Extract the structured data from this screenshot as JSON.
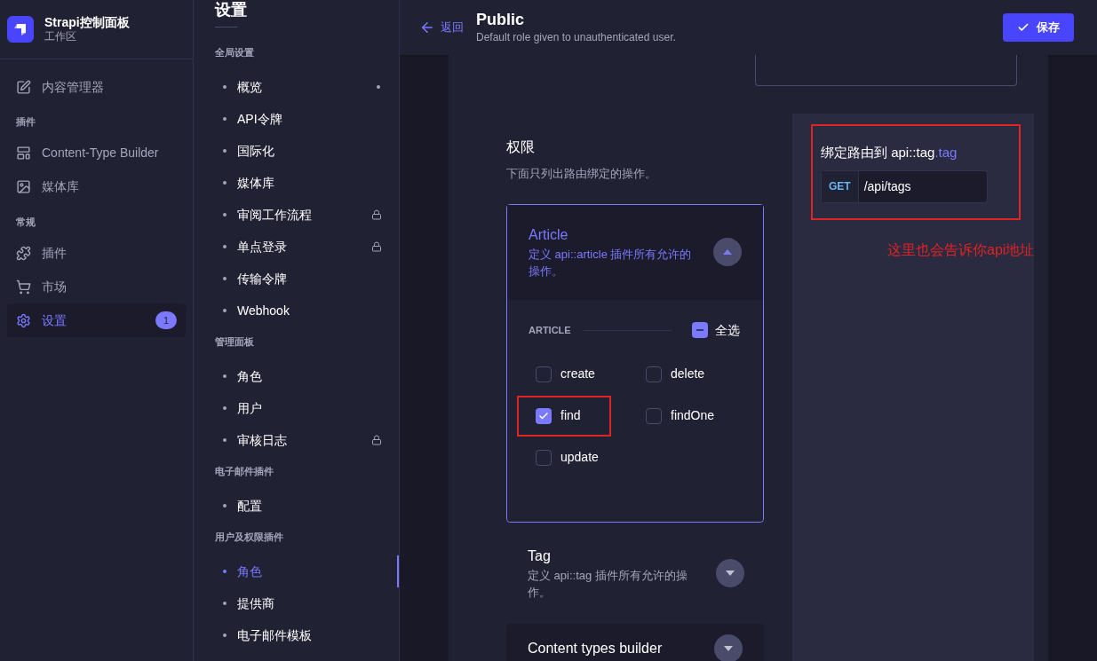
{
  "brand": {
    "title": "Strapi控制面板",
    "subtitle": "工作区"
  },
  "main_nav": [
    {
      "kind": "item",
      "label": "内容管理器",
      "selected": false
    },
    {
      "kind": "section",
      "label": "插件"
    },
    {
      "kind": "item",
      "label": "Content-Type Builder",
      "selected": false
    },
    {
      "kind": "item",
      "label": "媒体库",
      "selected": false
    },
    {
      "kind": "section",
      "label": "常规"
    },
    {
      "kind": "item",
      "label": "插件",
      "selected": false
    },
    {
      "kind": "item",
      "label": "市场",
      "selected": false
    },
    {
      "kind": "item",
      "label": "设置",
      "selected": true,
      "badge": "1"
    }
  ],
  "settings_nav": {
    "title": "设置",
    "sections": [
      {
        "label": "全局设置",
        "items": [
          {
            "label": "概览",
            "selected": false,
            "locked": false,
            "notice": true
          },
          {
            "label": "API令牌",
            "selected": false,
            "locked": false,
            "notice": false
          },
          {
            "label": "国际化",
            "selected": false,
            "locked": false,
            "notice": false
          },
          {
            "label": "媒体库",
            "selected": false,
            "locked": false,
            "notice": false
          },
          {
            "label": "审阅工作流程",
            "selected": false,
            "locked": true,
            "notice": false
          },
          {
            "label": "单点登录",
            "selected": false,
            "locked": true,
            "notice": false
          },
          {
            "label": "传输令牌",
            "selected": false,
            "locked": false,
            "notice": false
          },
          {
            "label": "Webhook",
            "selected": false,
            "locked": false,
            "notice": false
          }
        ]
      },
      {
        "label": "管理面板",
        "items": [
          {
            "label": "角色",
            "selected": false,
            "locked": false,
            "notice": false
          },
          {
            "label": "用户",
            "selected": false,
            "locked": false,
            "notice": false
          },
          {
            "label": "审核日志",
            "selected": false,
            "locked": true,
            "notice": false
          }
        ]
      },
      {
        "label": "电子邮件插件",
        "items": [
          {
            "label": "配置",
            "selected": false,
            "locked": false,
            "notice": false
          }
        ]
      },
      {
        "label": "用户及权限插件",
        "items": [
          {
            "label": "角色",
            "selected": true,
            "locked": false,
            "notice": false
          },
          {
            "label": "提供商",
            "selected": false,
            "locked": false,
            "notice": false
          },
          {
            "label": "电子邮件模板",
            "selected": false,
            "locked": false,
            "notice": false
          }
        ]
      }
    ]
  },
  "header": {
    "back": "返回",
    "title": "Public",
    "subtitle": "Default role given to unauthenticated user.",
    "save": "保存"
  },
  "permissions": {
    "title": "权限",
    "subtitle": "下面只列出路由绑定的操作。",
    "groups": [
      {
        "name": "Article",
        "description": "定义 api::article 插件所有允许的操作。",
        "expanded": true,
        "section_label": "ARTICLE",
        "select_all": {
          "label": "全选",
          "indeterminate": true
        },
        "actions": [
          {
            "label": "create",
            "checked": false,
            "highlighted": false
          },
          {
            "label": "delete",
            "checked": false,
            "highlighted": false
          },
          {
            "label": "find",
            "checked": true,
            "highlighted": true
          },
          {
            "label": "findOne",
            "checked": false,
            "highlighted": false
          },
          {
            "label": "update",
            "checked": false,
            "highlighted": false
          }
        ]
      },
      {
        "name": "Tag",
        "description": "定义 api::tag 插件所有允许的操作。",
        "expanded": false
      },
      {
        "name": "Content types builder",
        "expanded": false
      }
    ]
  },
  "route": {
    "title": "绑定路由到 api::tag",
    "title_suffix": ".tag",
    "method": "GET",
    "path": "/api/tags",
    "highlighted": true
  },
  "annotation": "这里也会告诉你api地址"
}
